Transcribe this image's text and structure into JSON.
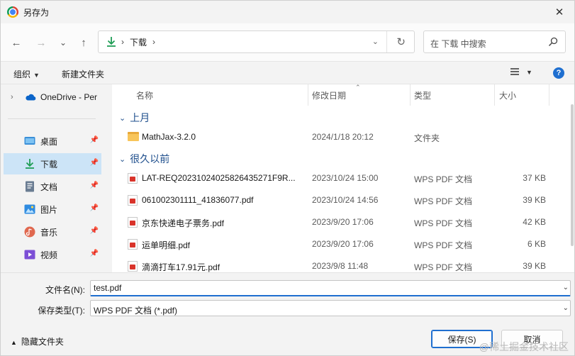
{
  "window": {
    "title": "另存为",
    "close": "✕"
  },
  "nav": {
    "back": "←",
    "forward": "→",
    "recent": "⌄",
    "up": "↑",
    "address_sep": "›",
    "address_location": "下载",
    "address_sep_end": "›",
    "address_dropdown": "⌄",
    "refresh": "↻",
    "search_placeholder": "在 下载 中搜索"
  },
  "toolbar": {
    "organize": "组织",
    "organize_caret": "▼",
    "new_folder": "新建文件夹",
    "view_caret": "▼",
    "help": "?"
  },
  "sidebar": {
    "onedrive": {
      "expand": "›",
      "label": "OneDrive - Per"
    },
    "items": [
      {
        "label": "桌面",
        "pin": "📌"
      },
      {
        "label": "下载",
        "pin": "📌",
        "selected": true
      },
      {
        "label": "文档",
        "pin": "📌"
      },
      {
        "label": "图片",
        "pin": "📌"
      },
      {
        "label": "音乐",
        "pin": "📌"
      },
      {
        "label": "视频",
        "pin": "📌"
      }
    ]
  },
  "columns": {
    "name": "名称",
    "date": "修改日期",
    "type": "类型",
    "size": "大小",
    "sort_caret": "⌃"
  },
  "groups": [
    {
      "label": "上月",
      "chev": "⌄",
      "files": [
        {
          "name": "MathJax-3.2.0",
          "date": "2024/1/18 20:12",
          "type": "文件夹",
          "size": "",
          "kind": "folder"
        }
      ]
    },
    {
      "label": "很久以前",
      "chev": "⌄",
      "files": [
        {
          "name": "LAT-REQ20231024025826435271F9R...",
          "date": "2023/10/24 15:00",
          "type": "WPS PDF 文档",
          "size": "37 KB",
          "kind": "pdf"
        },
        {
          "name": "061002301111_41836077.pdf",
          "date": "2023/10/24 14:56",
          "type": "WPS PDF 文档",
          "size": "39 KB",
          "kind": "pdf"
        },
        {
          "name": "京东快递电子票务.pdf",
          "date": "2023/9/20 17:06",
          "type": "WPS PDF 文档",
          "size": "42 KB",
          "kind": "pdf"
        },
        {
          "name": "运单明细.pdf",
          "date": "2023/9/20 17:06",
          "type": "WPS PDF 文档",
          "size": "6 KB",
          "kind": "pdf"
        },
        {
          "name": "滴滴打车17.91元.pdf",
          "date": "2023/9/8 11:48",
          "type": "WPS PDF 文档",
          "size": "39 KB",
          "kind": "pdf"
        }
      ]
    }
  ],
  "form": {
    "filename_label": "文件名(N):",
    "filename_value": "test.pdf",
    "filetype_label": "保存类型(T):",
    "filetype_value": "WPS PDF 文档 (*.pdf)",
    "dropdown": "⌄",
    "hide_folders": "隐藏文件夹",
    "hide_caret": "▲",
    "save": "保存(S)",
    "cancel": "取消"
  },
  "watermark": "@稀土掘金技术社区",
  "colors": {
    "accent": "#1f6fd0",
    "selected_bg": "#cce4f7",
    "group_text": "#1e4e8c",
    "pdf_red": "#d9342b",
    "folder_yellow": "#f8c55a"
  }
}
